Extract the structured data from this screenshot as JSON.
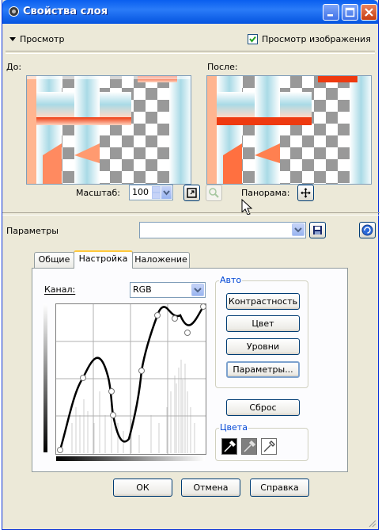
{
  "window": {
    "title": "Свойства слоя"
  },
  "preview_section": {
    "toggle_label": "Просмотр",
    "preview_image_label": "Просмотр изображения",
    "before_label": "До:",
    "after_label": "После:",
    "zoom_label": "Масштаб:",
    "zoom_value": "100",
    "pan_label": "Панорама:"
  },
  "params_section": {
    "label": "Параметры",
    "preset_value": ""
  },
  "tabs": [
    {
      "label": "Общие"
    },
    {
      "label": "Настройка"
    },
    {
      "label": "Наложение"
    }
  ],
  "curves": {
    "channel_label": "Канал:",
    "channel_value": "RGB",
    "auto_group_label": "Авто",
    "auto_buttons": [
      "Контрастность",
      "Цвет",
      "Уровни",
      "Параметры..."
    ],
    "reset_label": "Сброс",
    "colors_group_label": "Цвета"
  },
  "footer": {
    "ok": "ОК",
    "cancel": "Отмена",
    "help": "Справка"
  },
  "colors": {
    "titlebar": "#0A5FEF",
    "face": "#ECE9D8",
    "accent_tab": "#FFC83C"
  }
}
